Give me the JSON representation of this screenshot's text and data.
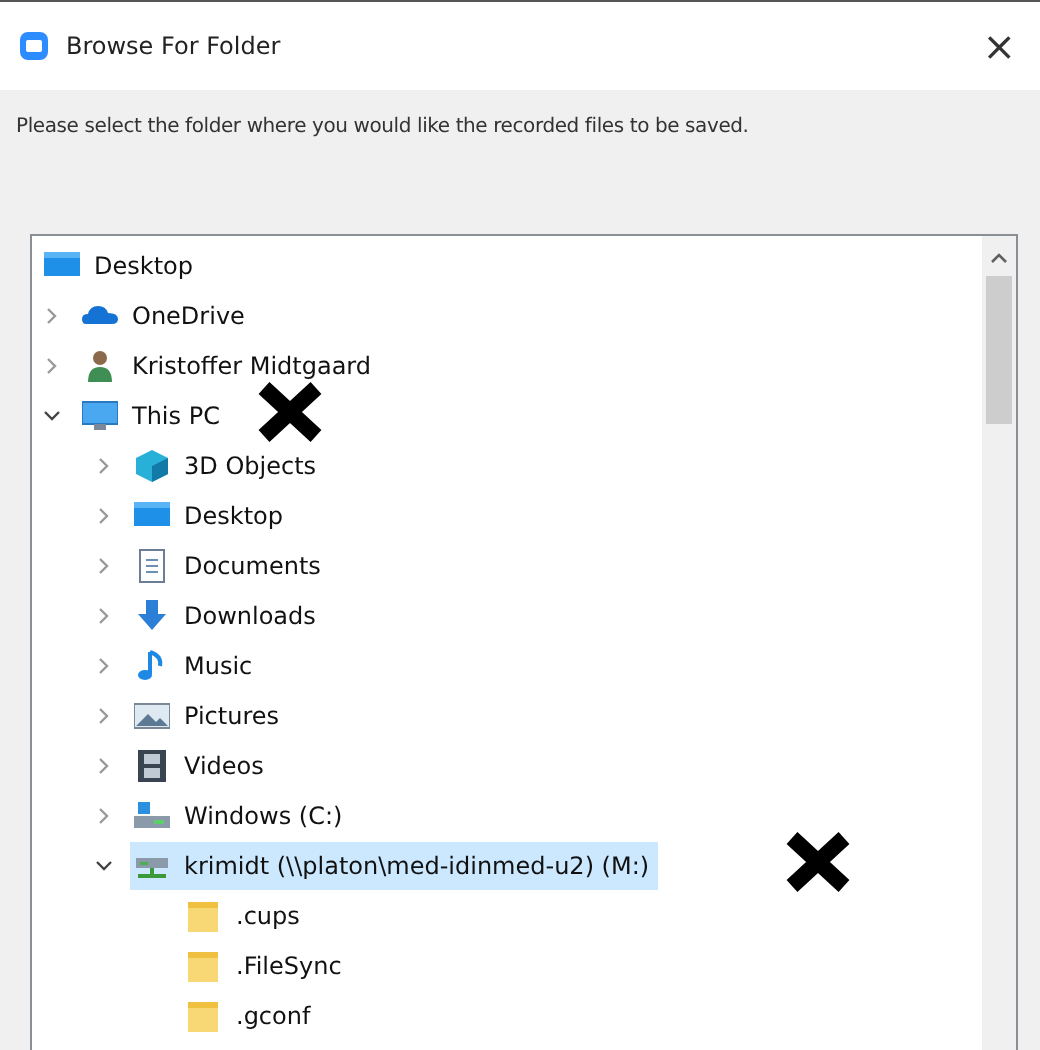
{
  "window": {
    "title": "Browse For Folder",
    "close": "×"
  },
  "message": "Please select the folder where you would like the recorded files to be saved.",
  "tree": [
    {
      "label": "Desktop",
      "kind": "desktop",
      "selected": false,
      "children": [
        {
          "label": "OneDrive",
          "kind": "cloud",
          "expanded": false,
          "selected": false
        },
        {
          "label": "Kristoffer Midtgaard",
          "kind": "user",
          "expanded": false,
          "selected": false
        },
        {
          "label": "This PC",
          "kind": "pc",
          "expanded": true,
          "selected": false,
          "children": [
            {
              "label": "3D Objects",
              "kind": "cube",
              "expanded": false,
              "selected": false
            },
            {
              "label": "Desktop",
              "kind": "desktop",
              "expanded": false,
              "selected": false
            },
            {
              "label": "Documents",
              "kind": "documents",
              "expanded": false,
              "selected": false
            },
            {
              "label": "Downloads",
              "kind": "download",
              "expanded": false,
              "selected": false
            },
            {
              "label": "Music",
              "kind": "music",
              "expanded": false,
              "selected": false
            },
            {
              "label": "Pictures",
              "kind": "pictures",
              "expanded": false,
              "selected": false
            },
            {
              "label": "Videos",
              "kind": "videos",
              "expanded": false,
              "selected": false
            },
            {
              "label": "Windows (C:)",
              "kind": "drive",
              "expanded": false,
              "selected": false
            },
            {
              "label": "krimidt (\\\\platon\\med-idinmed-u2) (M:)",
              "kind": "netdrive",
              "expanded": true,
              "selected": true,
              "children": [
                {
                  "label": ".cups",
                  "kind": "folder",
                  "selected": false
                },
                {
                  "label": ".FileSync",
                  "kind": "folder",
                  "selected": false
                },
                {
                  "label": ".gconf",
                  "kind": "folder",
                  "selected": false
                }
              ]
            }
          ]
        }
      ]
    }
  ]
}
